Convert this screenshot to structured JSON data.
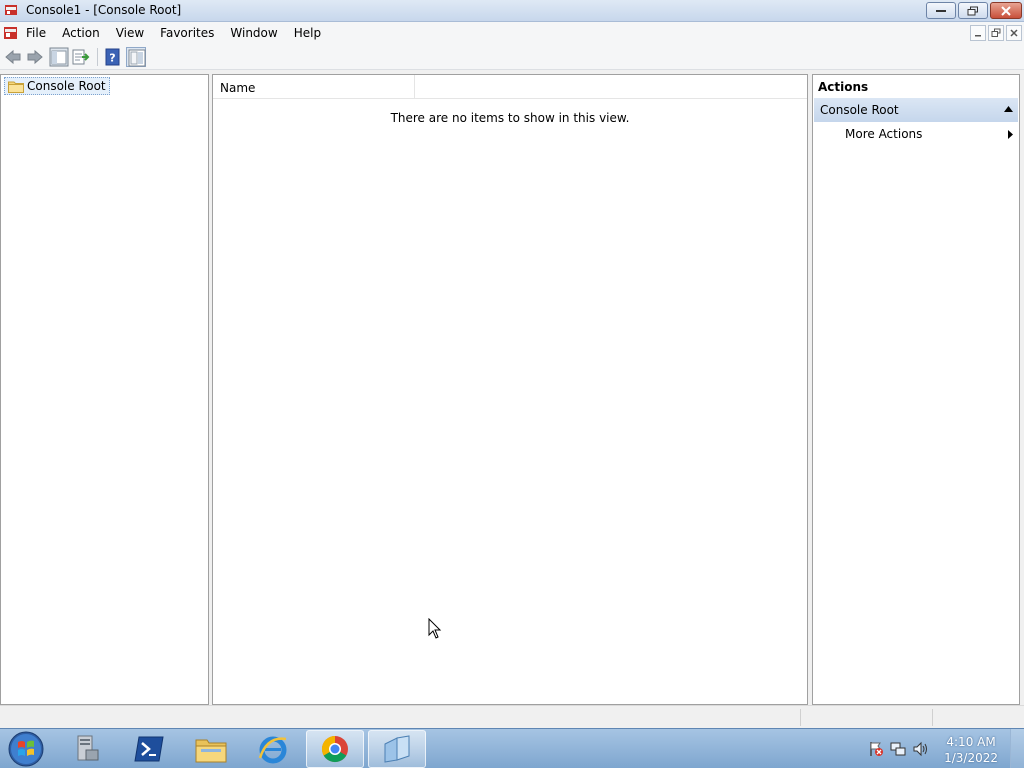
{
  "window": {
    "title": "Console1 - [Console Root]"
  },
  "menu": {
    "items": [
      "File",
      "Action",
      "View",
      "Favorites",
      "Window",
      "Help"
    ]
  },
  "tree": {
    "root_label": "Console Root"
  },
  "list": {
    "column_name": "Name",
    "empty_message": "There are no items to show in this view."
  },
  "actions": {
    "title": "Actions",
    "section_label": "Console Root",
    "more_actions_label": "More Actions"
  },
  "taskbar": {
    "apps": [
      "server-manager",
      "powershell",
      "file-explorer",
      "internet-explorer",
      "chrome",
      "mmc"
    ],
    "clock_time": "4:10 AM",
    "clock_date": "1/3/2022"
  },
  "colors": {
    "taskbar": "#7ea6cf",
    "titlebar": "#c7d7ec",
    "action_section": "#c5d6ec",
    "selection": "#e5f0fb"
  }
}
